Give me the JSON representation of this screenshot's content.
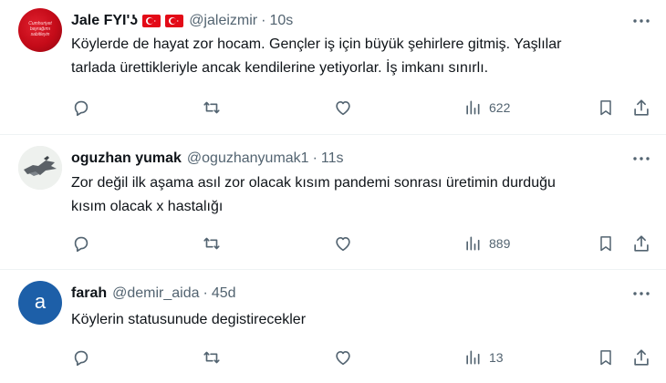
{
  "tweets": [
    {
      "name": "Jale FYI'ʖ",
      "handle": "@jaleizmir",
      "separator": "·",
      "time": "10s",
      "avatar_caption": "Cumhuriyet bayrağımı sabitleyin",
      "text_line1": "Köylerde de hayat zor hocam. Gençler iş için büyük şehirlere gitmiş. Yaşlılar",
      "text_line2": "tarlada ürettikleriyle ancak kendilerine yetiyorlar. İş imkanı sınırlı.",
      "views": "622",
      "flag_color": "#e30a17"
    },
    {
      "name": "oguzhan yumak",
      "handle": "@oguzhanyumak1",
      "separator": "·",
      "time": "11s",
      "text_line1": "Zor değil ilk aşama asıl zor olacak kısım pandemi sonrası üretimin durduğu",
      "text_line2": "kısım olacak x hastalığı",
      "views": "889"
    },
    {
      "name": "farah",
      "handle": "@demir_aida",
      "separator": "·",
      "time": "45d",
      "avatar_letter": "a",
      "text_line1": "Köylerin statusunude degistirecekler",
      "views": "13"
    }
  ],
  "colors": {
    "text_primary": "#0f1419",
    "text_secondary": "#536471",
    "divider": "#eff3f4",
    "avatar3_bg": "#1d5fa8"
  },
  "icons": [
    "more-icon",
    "reply-icon",
    "retweet-icon",
    "like-icon",
    "views-icon",
    "bookmark-icon",
    "share-icon",
    "turkish-flag-icon"
  ]
}
